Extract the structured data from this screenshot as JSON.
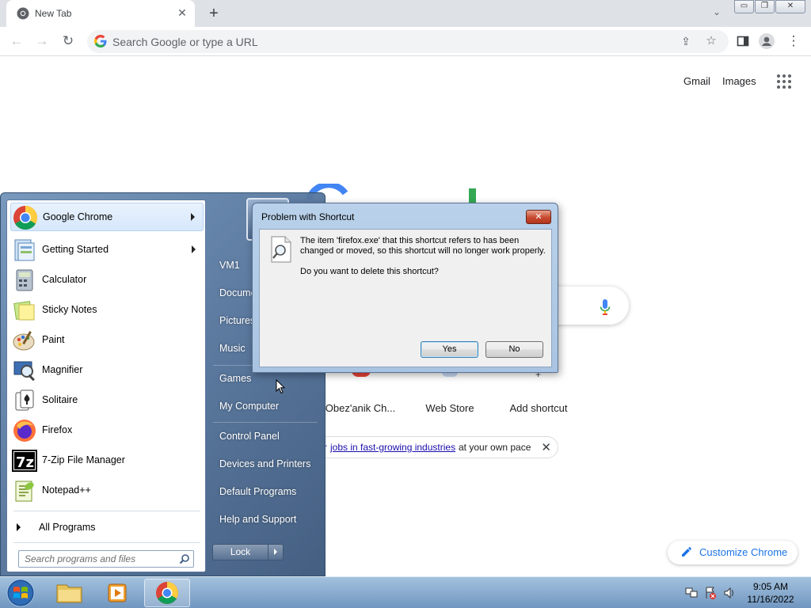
{
  "browser": {
    "tab_title": "New Tab",
    "omnibox_placeholder": "Search Google or type a URL"
  },
  "ntp": {
    "gmail": "Gmail",
    "images": "Images",
    "shortcuts": [
      "Obez'anik Ch...",
      "Web Store",
      "Add shortcut"
    ],
    "promo_link": "jobs in fast-growing industries",
    "promo_rest": "at your own pace",
    "promo_prefix": "r",
    "customize": "Customize Chrome"
  },
  "start_menu": {
    "programs": [
      {
        "label": "Google Chrome",
        "icon": "chrome-icon",
        "submenu": true
      },
      {
        "label": "Getting Started",
        "icon": "getting-started-icon",
        "submenu": true
      },
      {
        "label": "Calculator",
        "icon": "calculator-icon",
        "submenu": false
      },
      {
        "label": "Sticky Notes",
        "icon": "sticky-notes-icon",
        "submenu": false
      },
      {
        "label": "Paint",
        "icon": "paint-icon",
        "submenu": false
      },
      {
        "label": "Magnifier",
        "icon": "magnifier-icon",
        "submenu": false
      },
      {
        "label": "Solitaire",
        "icon": "solitaire-icon",
        "submenu": false
      },
      {
        "label": "Firefox",
        "icon": "firefox-icon",
        "submenu": false
      },
      {
        "label": "7-Zip File Manager",
        "icon": "7zip-icon",
        "submenu": false
      },
      {
        "label": "Notepad++",
        "icon": "notepadpp-icon",
        "submenu": false
      }
    ],
    "all_programs": "All Programs",
    "search_placeholder": "Search programs and files",
    "right_links": [
      "VM1",
      "Docume",
      "Pictures",
      "Music",
      "Games",
      "My Computer",
      "Control Panel",
      "Devices and Printers",
      "Default Programs",
      "Help and Support"
    ],
    "lock_label": "Lock"
  },
  "dialog": {
    "title": "Problem with Shortcut",
    "close": "✕",
    "message": "The item 'firefox.exe' that this shortcut refers to has been changed or moved, so this shortcut will no longer work properly.",
    "question": "Do you want to delete this shortcut?",
    "yes": "Yes",
    "no": "No"
  },
  "taskbar": {
    "time": "9:05 AM",
    "date": "11/16/2022"
  }
}
